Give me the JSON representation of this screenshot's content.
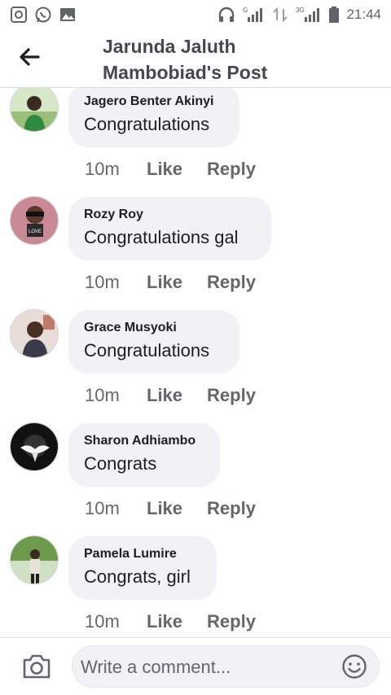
{
  "status_bar": {
    "time": "21:44",
    "icons": [
      "screen-record-icon",
      "whatsapp-icon",
      "gallery-icon",
      "headphones-icon",
      "signal-g-icon",
      "data-arrows-icon",
      "signal-3g-icon",
      "battery-icon"
    ]
  },
  "header": {
    "title_line1": "Jarunda Jaluth",
    "title_line2": "Mambobiad's Post"
  },
  "comments": [
    {
      "author": "Jagero Benter Akinyi",
      "text": "Congratulations",
      "time": "10m",
      "like": "Like",
      "reply": "Reply"
    },
    {
      "author": "Rozy Roy",
      "text": "Congratulations gal",
      "time": "10m",
      "like": "Like",
      "reply": "Reply"
    },
    {
      "author": "Grace Musyoki",
      "text": "Congratulations",
      "time": "10m",
      "like": "Like",
      "reply": "Reply"
    },
    {
      "author": "Sharon Adhiambo",
      "text": "Congrats",
      "time": "10m",
      "like": "Like",
      "reply": "Reply"
    },
    {
      "author": "Pamela Lumire",
      "text": "Congrats, girl",
      "time": "10m",
      "like": "Like",
      "reply": "Reply"
    }
  ],
  "composer": {
    "placeholder": "Write a comment...",
    "camera_icon": "camera-icon",
    "emoji_icon": "emoji-icon"
  },
  "colors": {
    "bubble": "#f0f2f5",
    "secondary_text": "#65676b",
    "divider": "#dadde1"
  }
}
